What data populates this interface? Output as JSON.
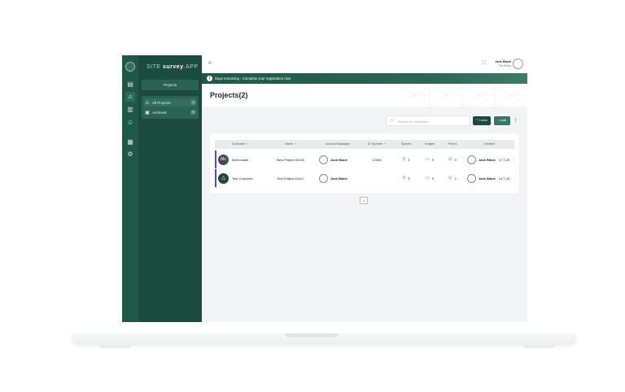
{
  "brand": {
    "prefix": "SITE",
    "bold": "survey",
    "suffix": ".APP"
  },
  "sidebar": {
    "projects_button": "Projects",
    "items": [
      {
        "label": "All Projects",
        "count": "2",
        "icon": "folder-icon"
      },
      {
        "label": "Archived",
        "count": "0",
        "icon": "archive-icon"
      }
    ]
  },
  "rail": {
    "icons": [
      "dashboard-icon",
      "home-icon",
      "building-icon",
      "users-icon",
      "store-icon",
      "settings-icon"
    ]
  },
  "topbar": {
    "menu_glyph": "≡",
    "user_name": "Jack Black",
    "user_org": "The Works"
  },
  "banner": {
    "text": "Days remaining - Complete your registration now"
  },
  "page": {
    "title": "Projects(2)"
  },
  "toolbar": {
    "search_placeholder": "Search by SiteSpace",
    "learn_label": "Learn",
    "add_label": "Add"
  },
  "table": {
    "columns": [
      "Customer",
      "Name",
      "Account Manager",
      "ID Number",
      "Spaces",
      "Images",
      "Forms",
      "Created"
    ],
    "rows": [
      {
        "avatar": "Mc",
        "customer": "McDonalds",
        "name": "New Project #2445",
        "manager": "Jack Black",
        "id": "12345",
        "spaces": "3",
        "images": "0",
        "forms": "0",
        "created_by": "Jack Black",
        "created_date": "17.7.25"
      },
      {
        "avatar": "",
        "customer": "Test Customer",
        "name": "Test Project #2417",
        "manager": "Jack Black",
        "id": "",
        "spaces": "3",
        "images": "0",
        "forms": "2",
        "created_by": "Jack Black",
        "created_date": "14.7.25"
      }
    ]
  },
  "pagination": {
    "current": "1"
  },
  "colors": {
    "sidebar_dark": "#1b4a3f",
    "rail": "#1f5749",
    "accent_bar": "#5b45d6"
  }
}
